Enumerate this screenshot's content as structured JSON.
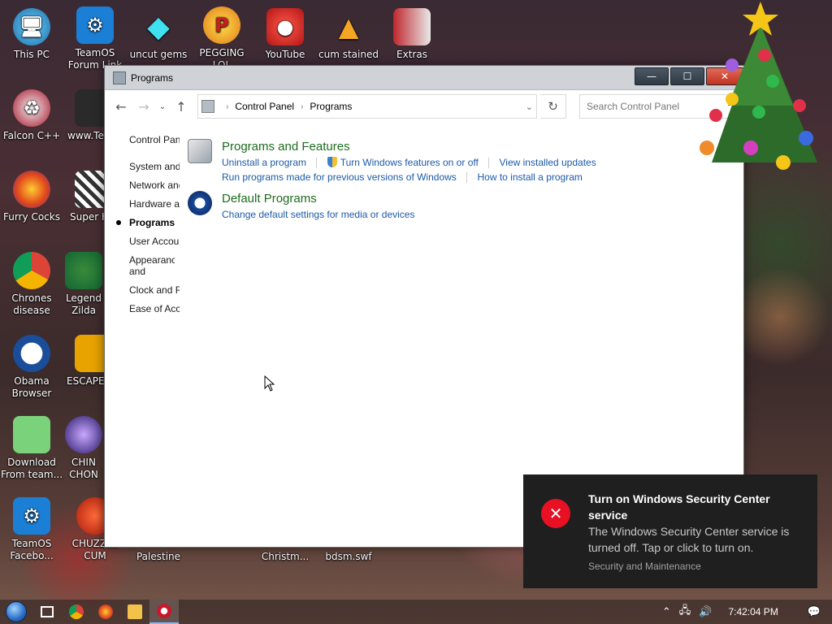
{
  "desktop_icons": [
    {
      "label": "This PC"
    },
    {
      "label": "TeamOS Forum Link"
    },
    {
      "label": "uncut gems"
    },
    {
      "label": "PEGGING LOL"
    },
    {
      "label": "YouTube"
    },
    {
      "label": "cum stained"
    },
    {
      "label": "Extras"
    },
    {
      "label": "Falcon C++"
    },
    {
      "label": "www.Tea"
    },
    {
      "label": "Furry Cocks"
    },
    {
      "label": "Super H"
    },
    {
      "label": "Chrones disease"
    },
    {
      "label": "Legend Zilda"
    },
    {
      "label": "Obama Browser"
    },
    {
      "label": "ESCAPE"
    },
    {
      "label": "Download From team..."
    },
    {
      "label": "CHIN CHON"
    },
    {
      "label": "TeamOS Facebo..."
    },
    {
      "label": "CHUZZLE CUM"
    },
    {
      "label": "Palestine"
    },
    {
      "label": "Christm..."
    },
    {
      "label": "bdsm.swf"
    }
  ],
  "window": {
    "title": "Programs",
    "buttons": {
      "minimize": "—",
      "maximize": "☐",
      "close": "✕"
    }
  },
  "address": {
    "crumbs": [
      "Control Panel",
      "Programs"
    ],
    "search_placeholder": "Search Control Panel"
  },
  "leftnav": [
    "Control Panel Home",
    "System and Security",
    "Network and Internet",
    "Hardware and Sound",
    "Programs",
    "User Accounts",
    "Appearance and Personalization",
    "Clock and Region",
    "Ease of Access"
  ],
  "categories": {
    "pf": {
      "title": "Programs and Features",
      "links": [
        "Uninstall a program",
        "Turn Windows features on or off",
        "View installed updates",
        "Run programs made for previous versions of Windows",
        "How to install a program"
      ]
    },
    "dp": {
      "title": "Default Programs",
      "links": [
        "Change default settings for media or devices"
      ]
    }
  },
  "toast": {
    "title": "Turn on Windows Security Center service",
    "body": "The Windows Security Center service is turned off. Tap or click to turn on.",
    "source": "Security and Maintenance"
  },
  "taskbar": {
    "clock": "7:42:04 PM"
  }
}
